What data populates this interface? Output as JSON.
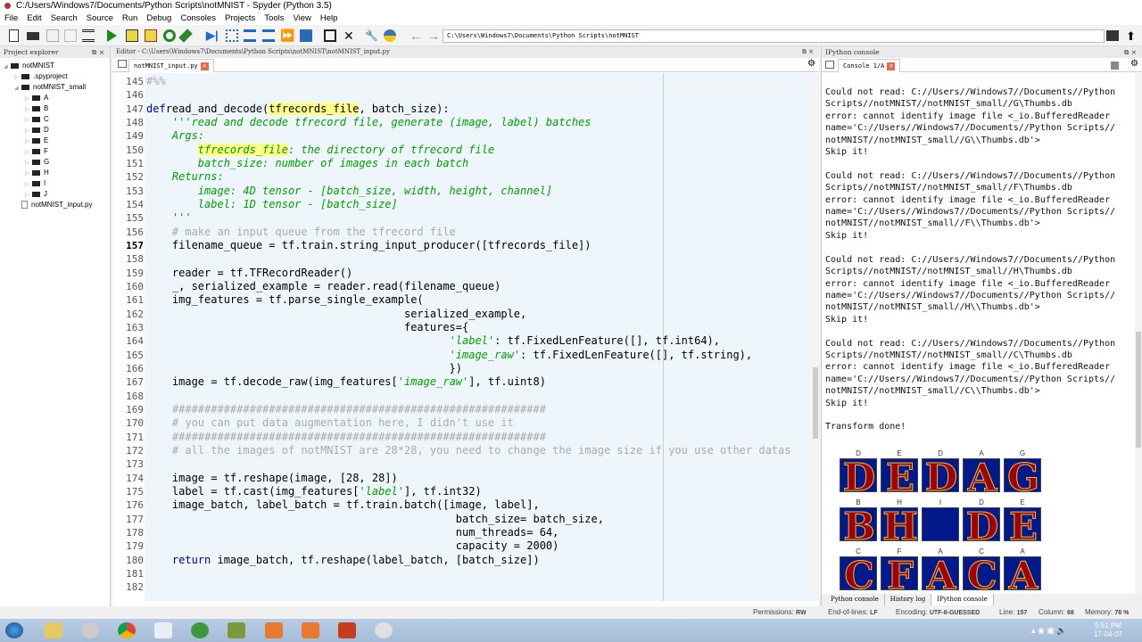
{
  "window": {
    "title": "C:/Users/Windows7/Documents/Python Scripts\\notMNIST - Spyder (Python 3.5)"
  },
  "menu": [
    "File",
    "Edit",
    "Search",
    "Source",
    "Run",
    "Debug",
    "Consoles",
    "Projects",
    "Tools",
    "View",
    "Help"
  ],
  "toolbar": {
    "path": "C:\\Users\\Windows7\\Documents\\Python Scripts\\notMNIST"
  },
  "project_explorer": {
    "title": "Project explorer",
    "items": [
      {
        "label": "notMNIST",
        "type": "folder",
        "depth": 0,
        "expanded": true
      },
      {
        "label": ".spyproject",
        "type": "folder",
        "depth": 1,
        "expanded": false
      },
      {
        "label": "notMNIST_small",
        "type": "folder",
        "depth": 1,
        "expanded": true
      },
      {
        "label": "A",
        "type": "folder",
        "depth": 2
      },
      {
        "label": "B",
        "type": "folder",
        "depth": 2
      },
      {
        "label": "C",
        "type": "folder",
        "depth": 2
      },
      {
        "label": "D",
        "type": "folder",
        "depth": 2
      },
      {
        "label": "E",
        "type": "folder",
        "depth": 2
      },
      {
        "label": "F",
        "type": "folder",
        "depth": 2
      },
      {
        "label": "G",
        "type": "folder",
        "depth": 2
      },
      {
        "label": "H",
        "type": "folder",
        "depth": 2
      },
      {
        "label": "I",
        "type": "folder",
        "depth": 2
      },
      {
        "label": "J",
        "type": "folder",
        "depth": 2
      },
      {
        "label": "notMNIST_input.py",
        "type": "file",
        "depth": 1
      }
    ]
  },
  "editor": {
    "title": "Editor - C:\\Users\\Windows7\\Documents\\Python Scripts\\notMNIST\\notMNIST_input.py",
    "tab": "notMNIST_input.py",
    "current_line": 157,
    "lines": [
      {
        "n": 145,
        "t": [
          [
            "cm",
            "#%%"
          ]
        ]
      },
      {
        "n": 146,
        "t": []
      },
      {
        "n": 147,
        "t": [
          [
            "kw",
            "def"
          ],
          [
            "",
            "read_and_decode("
          ],
          [
            "hl",
            "tfrecords_file"
          ],
          [
            "",
            ", batch_size):"
          ]
        ]
      },
      {
        "n": 148,
        "t": [
          [
            "str",
            "    '''read and decode tfrecord file, generate (image, label) batches"
          ]
        ]
      },
      {
        "n": 149,
        "t": [
          [
            "str",
            "    Args:"
          ]
        ]
      },
      {
        "n": 150,
        "t": [
          [
            "str",
            "        "
          ],
          [
            "str hl",
            "tfrecords_file"
          ],
          [
            "str",
            ": the directory of tfrecord file"
          ]
        ]
      },
      {
        "n": 151,
        "t": [
          [
            "str",
            "        batch_size: number of images in each batch"
          ]
        ]
      },
      {
        "n": 152,
        "t": [
          [
            "str",
            "    Returns:"
          ]
        ]
      },
      {
        "n": 153,
        "t": [
          [
            "str",
            "        image: 4D tensor - [batch_size, width, height, channel]"
          ]
        ]
      },
      {
        "n": 154,
        "t": [
          [
            "str",
            "        label: 1D tensor - [batch_size]"
          ]
        ]
      },
      {
        "n": 155,
        "t": [
          [
            "str",
            "    '''"
          ]
        ]
      },
      {
        "n": 156,
        "t": [
          [
            "cm",
            "    # make an input queue from the tfrecord file"
          ]
        ]
      },
      {
        "n": 157,
        "t": [
          [
            "",
            "    filename_queue = tf.train.string_input_producer([tfrecords_file])"
          ]
        ]
      },
      {
        "n": 158,
        "t": []
      },
      {
        "n": 159,
        "t": [
          [
            "",
            "    reader = tf.TFRecordReader()"
          ]
        ]
      },
      {
        "n": 160,
        "t": [
          [
            "",
            "    _, serialized_example = reader.read(filename_queue)"
          ]
        ]
      },
      {
        "n": 161,
        "t": [
          [
            "",
            "    img_features = tf.parse_single_example("
          ]
        ]
      },
      {
        "n": 162,
        "t": [
          [
            "",
            "                                        serialized_example,"
          ]
        ]
      },
      {
        "n": 163,
        "t": [
          [
            "",
            "                                        features={"
          ]
        ]
      },
      {
        "n": 164,
        "t": [
          [
            "",
            "                                               "
          ],
          [
            "str",
            "'label'"
          ],
          [
            "",
            ": tf.FixedLenFeature([], tf.int64),"
          ]
        ]
      },
      {
        "n": 165,
        "t": [
          [
            "",
            "                                               "
          ],
          [
            "str",
            "'image_raw'"
          ],
          [
            "",
            ": tf.FixedLenFeature([], tf.string),"
          ]
        ]
      },
      {
        "n": 166,
        "t": [
          [
            "",
            "                                               })"
          ]
        ]
      },
      {
        "n": 167,
        "t": [
          [
            "",
            "    image = tf.decode_raw(img_features["
          ],
          [
            "str",
            "'image_raw'"
          ],
          [
            "",
            "], tf.uint8)"
          ]
        ]
      },
      {
        "n": 168,
        "t": []
      },
      {
        "n": 169,
        "t": [
          [
            "cm",
            "    ##########################################################"
          ]
        ]
      },
      {
        "n": 170,
        "t": [
          [
            "cm",
            "    # you can put data augmentation here, I didn't use it"
          ]
        ]
      },
      {
        "n": 171,
        "t": [
          [
            "cm",
            "    ##########################################################"
          ]
        ]
      },
      {
        "n": 172,
        "t": [
          [
            "cm",
            "    # all the images of notMNIST are 28*28, you need to change the image size if you use other datas"
          ]
        ]
      },
      {
        "n": 173,
        "t": []
      },
      {
        "n": 174,
        "t": [
          [
            "",
            "    image = tf.reshape(image, [28, 28])"
          ]
        ]
      },
      {
        "n": 175,
        "t": [
          [
            "",
            "    label = tf.cast(img_features["
          ],
          [
            "str",
            "'label'"
          ],
          [
            "",
            "], tf.int32)"
          ]
        ]
      },
      {
        "n": 176,
        "t": [
          [
            "",
            "    image_batch, label_batch = tf.train.batch([image, label],"
          ]
        ]
      },
      {
        "n": 177,
        "t": [
          [
            "",
            "                                                batch_size= batch_size,"
          ]
        ]
      },
      {
        "n": 178,
        "t": [
          [
            "",
            "                                                num_threads= 64,"
          ]
        ]
      },
      {
        "n": 179,
        "t": [
          [
            "",
            "                                                capacity = 2000)"
          ]
        ]
      },
      {
        "n": 180,
        "t": [
          [
            "kw",
            "    return"
          ],
          [
            "",
            " image_batch, tf.reshape(label_batch, [batch_size])"
          ]
        ]
      },
      {
        "n": 181,
        "t": []
      },
      {
        "n": 182,
        "t": []
      }
    ]
  },
  "console": {
    "title": "IPython console",
    "tab": "Console 1/A",
    "output": "Could not read: C://Users//Windows7//Documents//Python\nScripts//notMNIST//notMNIST_small//G\\Thumbs.db\nerror: cannot identify image file <_io.BufferedReader\nname='C://Users//Windows7//Documents//Python Scripts//\nnotMNIST//notMNIST_small//G\\\\Thumbs.db'>\nSkip it!\n\nCould not read: C://Users//Windows7//Documents//Python\nScripts//notMNIST//notMNIST_small//F\\Thumbs.db\nerror: cannot identify image file <_io.BufferedReader\nname='C://Users//Windows7//Documents//Python Scripts//\nnotMNIST//notMNIST_small//F\\\\Thumbs.db'>\nSkip it!\n\nCould not read: C://Users//Windows7//Documents//Python\nScripts//notMNIST//notMNIST_small//H\\Thumbs.db\nerror: cannot identify image file <_io.BufferedReader\nname='C://Users//Windows7//Documents//Python Scripts//\nnotMNIST//notMNIST_small//H\\\\Thumbs.db'>\nSkip it!\n\nCould not read: C://Users//Windows7//Documents//Python\nScripts//notMNIST//notMNIST_small//C\\Thumbs.db\nerror: cannot identify image file <_io.BufferedReader\nname='C://Users//Windows7//Documents//Python Scripts//\nnotMNIST//notMNIST_small//C\\\\Thumbs.db'>\nSkip it!\n\nTransform done!",
    "image_labels": [
      "D",
      "E",
      "D",
      "A",
      "G",
      "B",
      "H",
      "I",
      "D",
      "E",
      "C",
      "F",
      "A",
      "C",
      "A"
    ],
    "bottom_tabs": [
      "Python console",
      "History log",
      "IPython console"
    ],
    "active_bottom_tab": "IPython console"
  },
  "status": {
    "permissions_label": "Permissions:",
    "permissions": "RW",
    "eol_label": "End-of-lines:",
    "eol": "LF",
    "encoding_label": "Encoding:",
    "encoding": "UTF-8-GUESSED",
    "line_label": "Line:",
    "line": "157",
    "column_label": "Column:",
    "column": "68",
    "memory_label": "Memory:",
    "memory": "78 %"
  },
  "taskbar": {
    "time": "5:51 PM",
    "date": "17-04-07"
  },
  "colors": {
    "editor_bg": "#eef6fc",
    "keyword": "#0000aa",
    "string": "#00a000",
    "comment": "#aaaaaa",
    "highlight": "#ffff88",
    "image_bg": "#001a8c",
    "image_fg": "#a00000"
  }
}
